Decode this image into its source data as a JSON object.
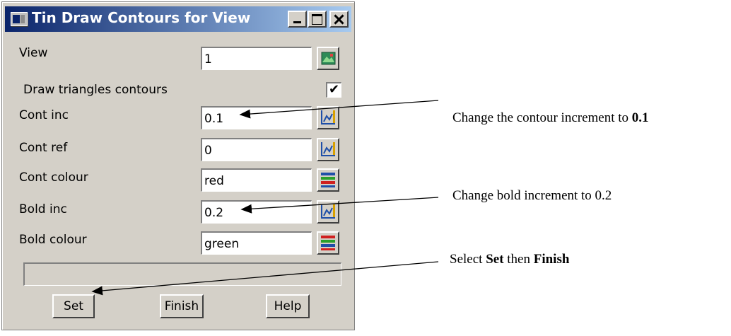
{
  "window": {
    "title": "Tin Draw Contours for View"
  },
  "form": {
    "view_label": "View",
    "view_value": "1",
    "draw_triangles_label": "Draw triangles contours",
    "draw_triangles_checked": true,
    "draw_triangles_mark": "✔",
    "cont_inc_label": "Cont inc",
    "cont_inc_value": "0.1",
    "cont_ref_label": "Cont ref",
    "cont_ref_value": "0",
    "cont_colour_label": "Cont colour",
    "cont_colour_value": "red",
    "bold_inc_label": "Bold inc",
    "bold_inc_value": "0.2",
    "bold_colour_label": "Bold colour",
    "bold_colour_value": "green",
    "status_text": ""
  },
  "buttons": {
    "set": "Set",
    "finish": "Finish",
    "help": "Help"
  },
  "annotations": {
    "cont_inc_note": "Change the contour increment to ",
    "cont_inc_note_bold": "0.1",
    "bold_inc_note": "Change bold increment to 0.2",
    "set_note_1": "Select ",
    "set_note_bold_1": "Set",
    "set_note_2": " then ",
    "set_note_bold_2": "Finish"
  },
  "icons": {
    "view_pick": "view-picker-icon",
    "number_pick": "value-picker-icon",
    "colour_pick": "colour-picker-icon"
  }
}
